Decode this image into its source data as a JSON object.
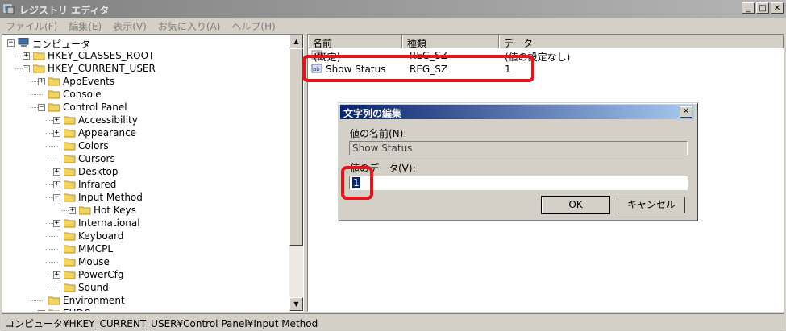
{
  "window": {
    "title": "レジストリ エディタ"
  },
  "menu": [
    "ファイル(F)",
    "編集(E)",
    "表示(V)",
    "お気に入り(A)",
    "ヘルプ(H)"
  ],
  "tree": [
    {
      "label": "コンピュータ",
      "depth": 0,
      "expander": "−",
      "icon": "computer-icon"
    },
    {
      "label": "HKEY_CLASSES_ROOT",
      "depth": 1,
      "expander": "+",
      "icon": "folder-icon"
    },
    {
      "label": "HKEY_CURRENT_USER",
      "depth": 1,
      "expander": "−",
      "icon": "folder-icon"
    },
    {
      "label": "AppEvents",
      "depth": 2,
      "expander": "+",
      "icon": "folder-icon"
    },
    {
      "label": "Console",
      "depth": 2,
      "expander": "",
      "icon": "folder-icon"
    },
    {
      "label": "Control Panel",
      "depth": 2,
      "expander": "−",
      "icon": "folder-icon"
    },
    {
      "label": "Accessibility",
      "depth": 3,
      "expander": "+",
      "icon": "folder-icon"
    },
    {
      "label": "Appearance",
      "depth": 3,
      "expander": "+",
      "icon": "folder-icon"
    },
    {
      "label": "Colors",
      "depth": 3,
      "expander": "",
      "icon": "folder-icon"
    },
    {
      "label": "Cursors",
      "depth": 3,
      "expander": "",
      "icon": "folder-icon"
    },
    {
      "label": "Desktop",
      "depth": 3,
      "expander": "+",
      "icon": "folder-icon"
    },
    {
      "label": "Infrared",
      "depth": 3,
      "expander": "+",
      "icon": "folder-icon"
    },
    {
      "label": "Input Method",
      "depth": 3,
      "expander": "−",
      "icon": "folder-icon"
    },
    {
      "label": "Hot Keys",
      "depth": 4,
      "expander": "+",
      "icon": "folder-icon"
    },
    {
      "label": "International",
      "depth": 3,
      "expander": "+",
      "icon": "folder-icon"
    },
    {
      "label": "Keyboard",
      "depth": 3,
      "expander": "",
      "icon": "folder-icon"
    },
    {
      "label": "MMCPL",
      "depth": 3,
      "expander": "",
      "icon": "folder-icon"
    },
    {
      "label": "Mouse",
      "depth": 3,
      "expander": "",
      "icon": "folder-icon"
    },
    {
      "label": "PowerCfg",
      "depth": 3,
      "expander": "+",
      "icon": "folder-icon"
    },
    {
      "label": "Sound",
      "depth": 3,
      "expander": "",
      "icon": "folder-icon"
    },
    {
      "label": "Environment",
      "depth": 2,
      "expander": "",
      "icon": "folder-icon"
    },
    {
      "label": "EUDC",
      "depth": 2,
      "expander": "+",
      "icon": "folder-icon"
    }
  ],
  "list": {
    "columns": [
      "名前",
      "種類",
      "データ"
    ],
    "rows": [
      {
        "name": "(既定)",
        "type": "REG_SZ",
        "data": "(値の設定なし)",
        "icon": "string-value-icon"
      },
      {
        "name": "Show Status",
        "type": "REG_SZ",
        "data": "1",
        "icon": "binary-value-icon"
      }
    ]
  },
  "dialog": {
    "title": "文字列の編集",
    "close": "✕",
    "name_label": "値の名前(N):",
    "name_value": "Show Status",
    "data_label": "値のデータ(V):",
    "data_value": "1",
    "ok": "OK",
    "cancel": "キャンセル"
  },
  "window_buttons": {
    "minimize": "_",
    "maximize": "□",
    "close": "✕"
  },
  "status": "コンピュータ¥HKEY_CURRENT_USER¥Control Panel¥Input Method",
  "colors": {
    "highlight": "#e8141d",
    "dialog_title": "#0a246a",
    "folder": "#f4d35e"
  }
}
